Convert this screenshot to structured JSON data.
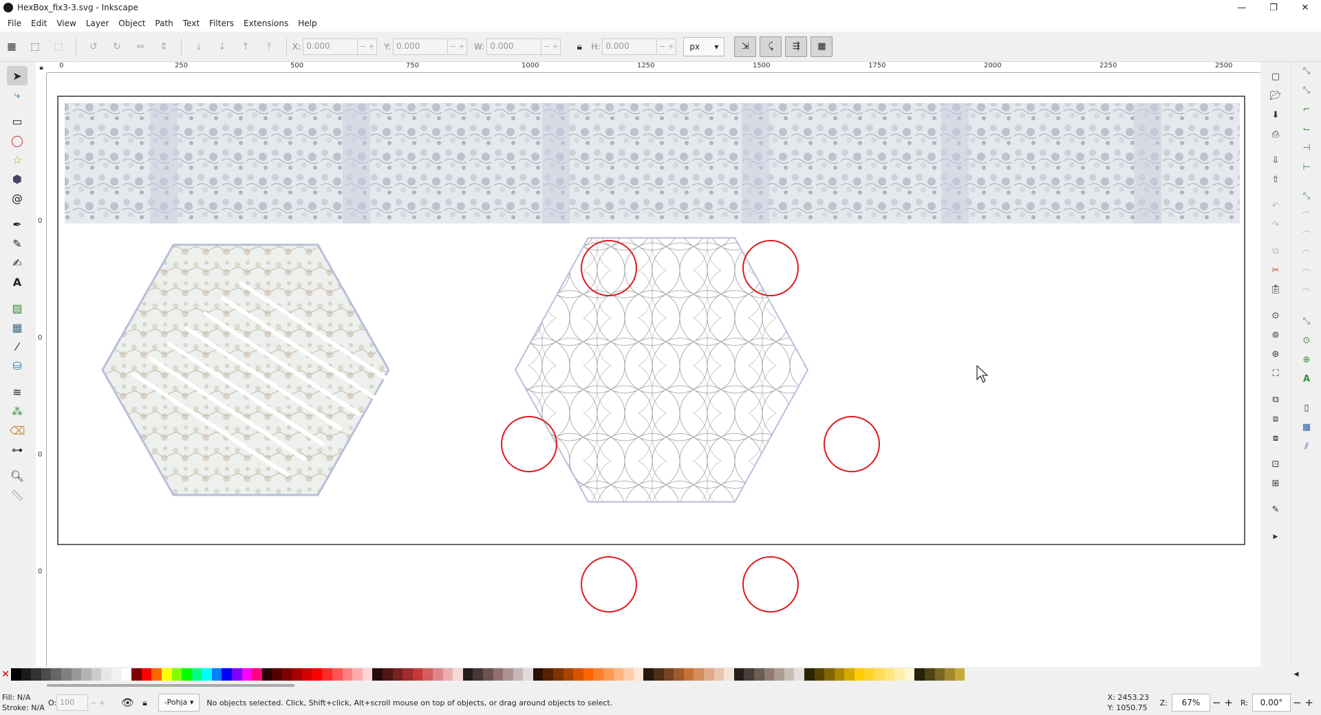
{
  "window": {
    "title": "HexBox_fix3-3.svg - Inkscape",
    "controls": [
      "—",
      "❐",
      "✕"
    ]
  },
  "menu": [
    "File",
    "Edit",
    "View",
    "Layer",
    "Object",
    "Path",
    "Text",
    "Filters",
    "Extensions",
    "Help"
  ],
  "toolbar": {
    "x": {
      "label": "X:",
      "value": "0.000"
    },
    "y": {
      "label": "Y:",
      "value": "0.000"
    },
    "w": {
      "label": "W:",
      "value": "0.000"
    },
    "h": {
      "label": "H:",
      "value": "0.000"
    },
    "unit": "px"
  },
  "ruler_top": [
    "0",
    "250",
    "500",
    "750",
    "1000",
    "1250",
    "1500",
    "1750",
    "2000",
    "2250",
    "2500"
  ],
  "ruler_left": [
    "0",
    "0",
    "0",
    "0"
  ],
  "status": {
    "fill_label": "Fill:",
    "fill_value": "N/A",
    "stroke_label": "Stroke:",
    "stroke_value": "N/A",
    "opacity_label": "O:",
    "opacity_value": "100",
    "layer": "-Pohja",
    "message": "No objects selected. Click, Shift+click, Alt+scroll mouse on top of objects, or drag around objects to select.",
    "cursor_x": "X: 2453.23",
    "cursor_y": "Y: 1050.75",
    "zoom_label": "Z:",
    "zoom_value": "67%",
    "rotation_label": "R:",
    "rotation_value": "0.00°"
  },
  "colors": {
    "accent": "#e01818",
    "palette": [
      "#000000",
      "#1a1a1a",
      "#333333",
      "#4d4d4d",
      "#666666",
      "#808080",
      "#999999",
      "#b3b3b3",
      "#cccccc",
      "#e6e6e6",
      "#f2f2f2",
      "#ffffff",
      "#800000",
      "#ff0000",
      "#ff6600",
      "#ffff00",
      "#80ff00",
      "#00ff00",
      "#00ff80",
      "#00ffff",
      "#0080ff",
      "#0000ff",
      "#8000ff",
      "#ff00ff",
      "#ff0080",
      "#2b0000",
      "#550000",
      "#800000",
      "#aa0000",
      "#d40000",
      "#ff0000",
      "#ff2a2a",
      "#ff5555",
      "#ff8080",
      "#ffaaaa",
      "#ffd5d5",
      "#280b0b",
      "#501616",
      "#782121",
      "#a02c2c",
      "#c83737",
      "#d35f5f",
      "#de8787",
      "#e9afaf",
      "#f4d7d7",
      "#241c1c",
      "#483737",
      "#6c5353",
      "#916f6f",
      "#ac9393",
      "#c8b7b7",
      "#e3dbdb",
      "#2b1100",
      "#552200",
      "#803300",
      "#aa4400",
      "#d45500",
      "#ff6600",
      "#ff7f2a",
      "#ff9955",
      "#ffb380",
      "#ffccaa",
      "#ffe6d5",
      "#28170b",
      "#502d16",
      "#784421",
      "#a05a2c",
      "#c87137",
      "#d38d5f",
      "#deaa87",
      "#e9c6af",
      "#f4e3d7",
      "#241f1c",
      "#483e37",
      "#6c5d53",
      "#917c6f",
      "#ac9d93",
      "#c8beb7",
      "#e3dedb",
      "#2b2200",
      "#554400",
      "#806600",
      "#aa8800",
      "#d4aa00",
      "#ffcc00",
      "#ffd42a",
      "#ffdd55",
      "#ffe680",
      "#ffeeaa",
      "#fff6d5",
      "#28220b",
      "#504416",
      "#786721",
      "#a0892c",
      "#c8ab37"
    ]
  }
}
